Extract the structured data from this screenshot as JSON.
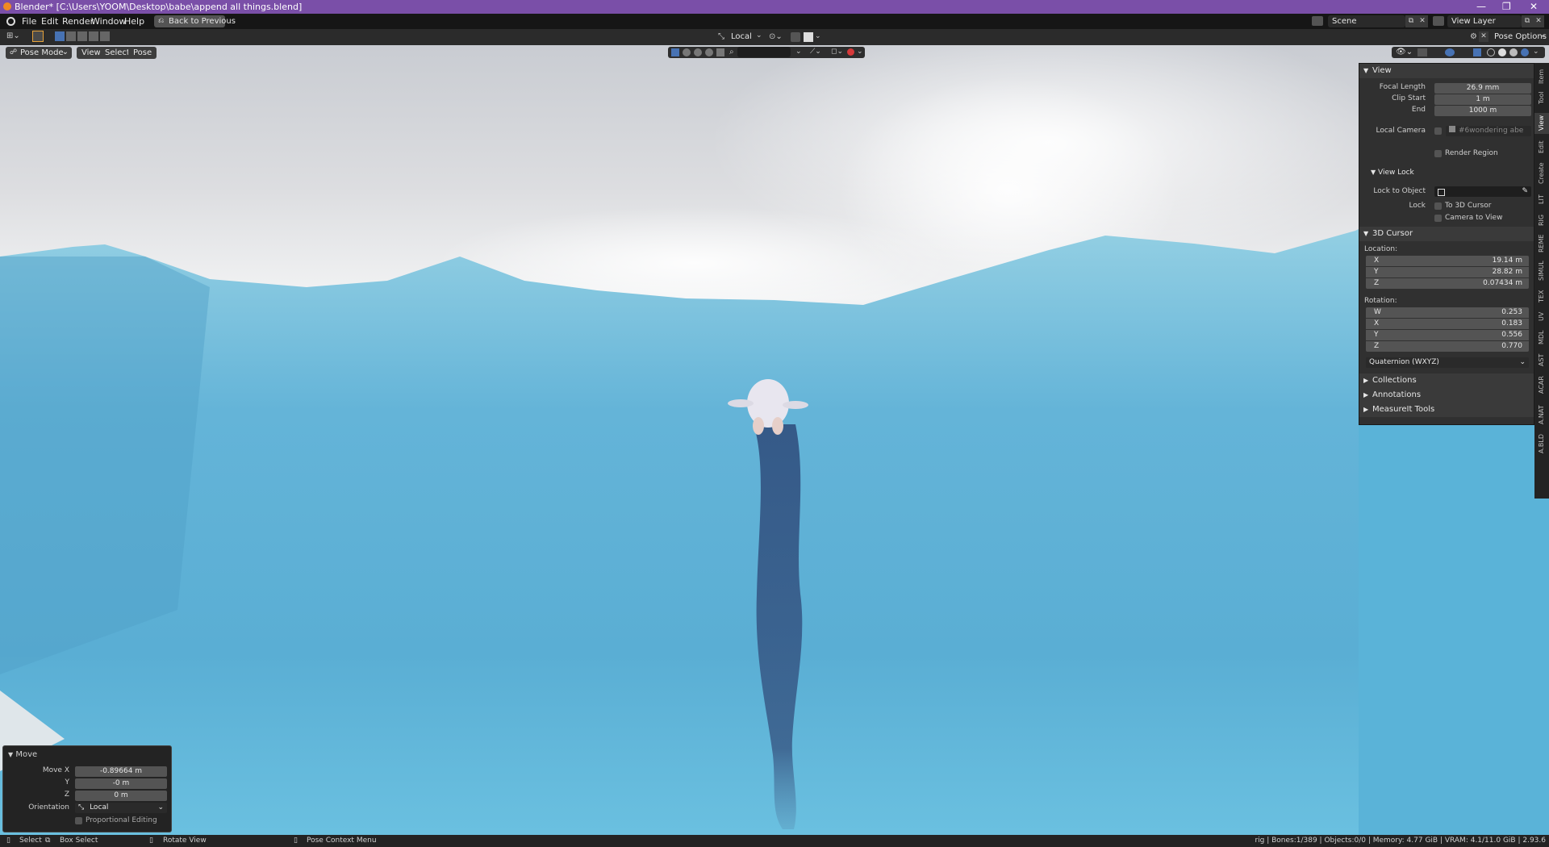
{
  "window": {
    "title": "Blender* [C:\\Users\\YOOM\\Desktop\\babe\\append all things.blend]",
    "controls": [
      "—",
      "❐",
      "✕"
    ]
  },
  "menubar": {
    "items": [
      "File",
      "Edit",
      "Render",
      "Window",
      "Help"
    ],
    "back_button": "Back to Previous",
    "scene": "Scene",
    "view_layer": "View Layer"
  },
  "toolheader": {
    "orientation": "Local",
    "pose_options": "Pose Options"
  },
  "viewport_header": {
    "mode": "Pose Mode",
    "menus": [
      "View",
      "Select",
      "Pose"
    ]
  },
  "npanel": {
    "view": {
      "title": "View",
      "focal_length_label": "Focal Length",
      "focal_length": "26.9 mm",
      "clip_start_label": "Clip Start",
      "clip_start": "1 m",
      "end_label": "End",
      "end": "1000 m",
      "local_camera_label": "Local Camera",
      "local_camera_value": "#6wondering abe",
      "render_region": "Render Region",
      "view_lock_title": "View Lock",
      "lock_to_object_label": "Lock to Object",
      "lock_label": "Lock",
      "to_3d_cursor": "To 3D Cursor",
      "camera_to_view": "Camera to View"
    },
    "cursor": {
      "title": "3D Cursor",
      "location_label": "Location:",
      "location": [
        {
          "axis": "X",
          "value": "19.14 m"
        },
        {
          "axis": "Y",
          "value": "28.82 m"
        },
        {
          "axis": "Z",
          "value": "0.07434 m"
        }
      ],
      "rotation_label": "Rotation:",
      "rotation": [
        {
          "axis": "W",
          "value": "0.253"
        },
        {
          "axis": "X",
          "value": "0.183"
        },
        {
          "axis": "Y",
          "value": "0.556"
        },
        {
          "axis": "Z",
          "value": "0.770"
        }
      ],
      "rotation_mode": "Quaternion (WXYZ)"
    },
    "collapsed": [
      "Collections",
      "Annotations",
      "MeasureIt Tools"
    ]
  },
  "side_tabs": [
    "Item",
    "Tool",
    "View",
    "Edit",
    "Create",
    "LIT",
    "RIG",
    "REME",
    "SIMUL",
    "TEX",
    "UV",
    "MDL",
    "AST",
    "ACAR",
    "A.NAT",
    "A.BLD"
  ],
  "operator_panel": {
    "title": "Move",
    "move_x_label": "Move X",
    "move_x": "-0.89664 m",
    "y_label": "Y",
    "y": "-0 m",
    "z_label": "Z",
    "z": "0 m",
    "orientation_label": "Orientation",
    "orientation": "Local",
    "proportional_editing": "Proportional Editing"
  },
  "statusbar": {
    "select": "Select",
    "box_select": "Box Select",
    "rotate_view": "Rotate View",
    "context_menu": "Pose Context Menu",
    "stats": "rig | Bones:1/389 | Objects:0/0 | Memory: 4.77 GiB | VRAM: 4.1/11.0 GiB | 2.93.6"
  },
  "colors": {
    "titlebar": "#7a4fa8",
    "panel_bg": "#303030",
    "field": "#545454",
    "water": "#5cb0d4"
  }
}
